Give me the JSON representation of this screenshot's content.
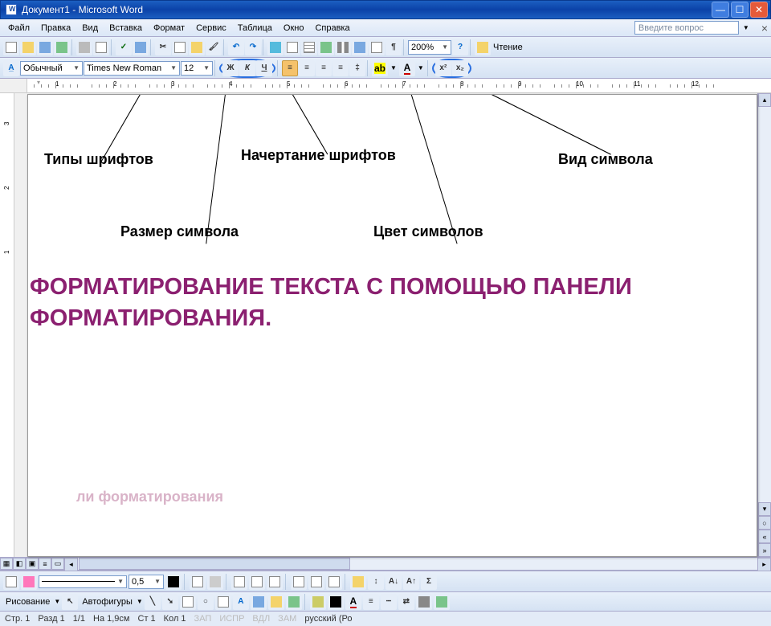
{
  "title": "Документ1 - Microsoft Word",
  "menu": [
    "Файл",
    "Правка",
    "Вид",
    "Вставка",
    "Формат",
    "Сервис",
    "Таблица",
    "Окно",
    "Справка"
  ],
  "help_placeholder": "Введите вопрос",
  "fmt": {
    "style": "Обычный",
    "font": "Times New Roman",
    "size": "12",
    "bold": "Ж",
    "italic": "К",
    "underline": "Ч",
    "sup": "x²",
    "sub": "x₂",
    "zoom": "200%",
    "read": "Чтение"
  },
  "ruler_nums": [
    "1",
    "2",
    "3",
    "4",
    "5",
    "6",
    "7",
    "8",
    "9",
    "10",
    "11",
    "12"
  ],
  "vruler_nums": [
    "3",
    "2",
    "1"
  ],
  "labels": {
    "font_types": "Типы шрифтов",
    "style": "Начертание шрифтов",
    "symbol_kind": "Вид символа",
    "size": "Размер символа",
    "color": "Цвет символов"
  },
  "heading": "ФОРМАТИРОВАНИЕ ТЕКСТА С ПОМОЩЬЮ ПАНЕЛИ ФОРМАТИРОВАНИЯ.",
  "ghost": "ли форматирования",
  "bottom": {
    "weight": "0,5",
    "draw": "Рисование",
    "autoshapes": "Автофигуры"
  },
  "status": {
    "page": "Стр. 1",
    "sec": "Разд 1",
    "pp": "1/1",
    "at": "На 1,9см",
    "ln": "Ст 1",
    "col": "Кол 1",
    "rec": "ЗАП",
    "trk": "ИСПР",
    "ext": "ВДЛ",
    "ovr": "ЗАМ",
    "lang": "русский (Ро"
  }
}
